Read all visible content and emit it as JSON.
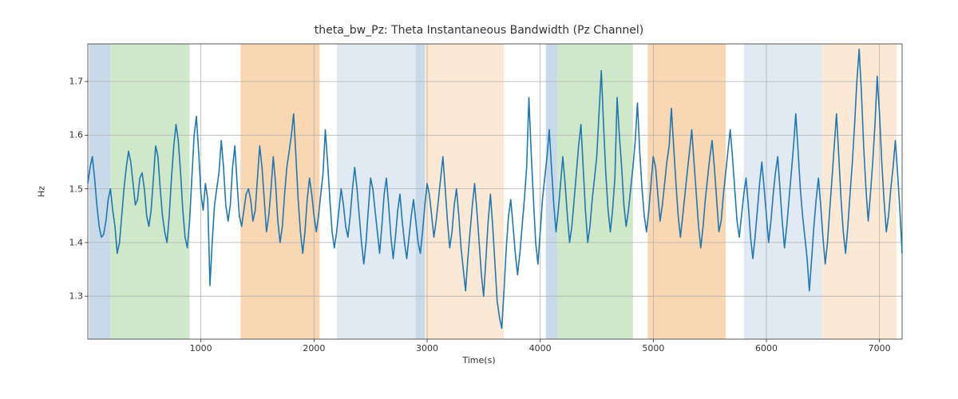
{
  "chart_data": {
    "type": "line",
    "title": "theta_bw_Pz: Theta Instantaneous Bandwidth (Pz Channel)",
    "xlabel": "Time(s)",
    "ylabel": "Hz",
    "xlim": [
      0,
      7200
    ],
    "ylim": [
      1.22,
      1.77
    ],
    "xticks": [
      1000,
      2000,
      3000,
      4000,
      5000,
      6000,
      7000
    ],
    "yticks": [
      1.3,
      1.4,
      1.5,
      1.6,
      1.7
    ],
    "bands": [
      {
        "x0": 10,
        "x1": 200,
        "color": "#b6cde2",
        "alpha": 0.75
      },
      {
        "x0": 200,
        "x1": 900,
        "color": "#bfe0b8",
        "alpha": 0.75
      },
      {
        "x0": 1350,
        "x1": 2050,
        "color": "#f7c999",
        "alpha": 0.75
      },
      {
        "x0": 2200,
        "x1": 2900,
        "color": "#d7e3ee",
        "alpha": 0.75
      },
      {
        "x0": 2900,
        "x1": 2980,
        "color": "#b6cde2",
        "alpha": 0.75
      },
      {
        "x0": 2980,
        "x1": 3680,
        "color": "#fbe2c7",
        "alpha": 0.75
      },
      {
        "x0": 4050,
        "x1": 4150,
        "color": "#b6cde2",
        "alpha": 0.75
      },
      {
        "x0": 4150,
        "x1": 4820,
        "color": "#bfe0b8",
        "alpha": 0.75
      },
      {
        "x0": 4950,
        "x1": 5640,
        "color": "#f7c999",
        "alpha": 0.75
      },
      {
        "x0": 5800,
        "x1": 6490,
        "color": "#d7e3ee",
        "alpha": 0.75
      },
      {
        "x0": 6490,
        "x1": 7150,
        "color": "#fbe2c7",
        "alpha": 0.75
      }
    ],
    "series": [
      {
        "name": "theta_bw_Pz",
        "color": "#1f77b4",
        "x_step": 20,
        "x_start": 0,
        "values": [
          1.51,
          1.54,
          1.56,
          1.52,
          1.47,
          1.43,
          1.41,
          1.415,
          1.44,
          1.48,
          1.5,
          1.46,
          1.43,
          1.38,
          1.4,
          1.45,
          1.5,
          1.54,
          1.57,
          1.55,
          1.51,
          1.47,
          1.48,
          1.52,
          1.53,
          1.5,
          1.45,
          1.43,
          1.46,
          1.52,
          1.58,
          1.56,
          1.5,
          1.45,
          1.42,
          1.4,
          1.45,
          1.52,
          1.58,
          1.62,
          1.59,
          1.53,
          1.46,
          1.41,
          1.39,
          1.44,
          1.52,
          1.6,
          1.635,
          1.57,
          1.49,
          1.46,
          1.51,
          1.48,
          1.32,
          1.4,
          1.47,
          1.5,
          1.53,
          1.59,
          1.54,
          1.47,
          1.44,
          1.47,
          1.54,
          1.58,
          1.51,
          1.45,
          1.43,
          1.46,
          1.49,
          1.5,
          1.48,
          1.44,
          1.46,
          1.52,
          1.58,
          1.54,
          1.48,
          1.42,
          1.45,
          1.5,
          1.56,
          1.51,
          1.44,
          1.4,
          1.43,
          1.49,
          1.54,
          1.57,
          1.6,
          1.64,
          1.56,
          1.48,
          1.42,
          1.38,
          1.42,
          1.48,
          1.52,
          1.49,
          1.45,
          1.42,
          1.45,
          1.49,
          1.53,
          1.61,
          1.55,
          1.48,
          1.42,
          1.39,
          1.42,
          1.46,
          1.5,
          1.47,
          1.43,
          1.41,
          1.45,
          1.5,
          1.54,
          1.5,
          1.45,
          1.4,
          1.36,
          1.4,
          1.46,
          1.52,
          1.5,
          1.46,
          1.42,
          1.38,
          1.43,
          1.49,
          1.52,
          1.47,
          1.41,
          1.37,
          1.41,
          1.46,
          1.49,
          1.44,
          1.4,
          1.37,
          1.41,
          1.45,
          1.48,
          1.44,
          1.4,
          1.38,
          1.42,
          1.47,
          1.51,
          1.49,
          1.45,
          1.41,
          1.44,
          1.48,
          1.52,
          1.56,
          1.5,
          1.44,
          1.39,
          1.42,
          1.47,
          1.5,
          1.45,
          1.39,
          1.35,
          1.31,
          1.37,
          1.42,
          1.47,
          1.51,
          1.46,
          1.4,
          1.34,
          1.3,
          1.37,
          1.44,
          1.49,
          1.43,
          1.36,
          1.29,
          1.26,
          1.24,
          1.31,
          1.39,
          1.45,
          1.48,
          1.43,
          1.38,
          1.34,
          1.38,
          1.43,
          1.48,
          1.54,
          1.67,
          1.57,
          1.48,
          1.4,
          1.36,
          1.42,
          1.48,
          1.52,
          1.56,
          1.61,
          1.54,
          1.47,
          1.42,
          1.46,
          1.51,
          1.56,
          1.51,
          1.45,
          1.4,
          1.43,
          1.48,
          1.53,
          1.58,
          1.62,
          1.54,
          1.46,
          1.4,
          1.43,
          1.48,
          1.52,
          1.56,
          1.64,
          1.72,
          1.62,
          1.53,
          1.46,
          1.42,
          1.46,
          1.52,
          1.67,
          1.6,
          1.54,
          1.47,
          1.43,
          1.46,
          1.5,
          1.54,
          1.59,
          1.66,
          1.57,
          1.5,
          1.45,
          1.42,
          1.46,
          1.51,
          1.56,
          1.54,
          1.49,
          1.44,
          1.47,
          1.51,
          1.55,
          1.58,
          1.65,
          1.58,
          1.51,
          1.45,
          1.41,
          1.45,
          1.49,
          1.53,
          1.57,
          1.61,
          1.55,
          1.49,
          1.43,
          1.39,
          1.43,
          1.48,
          1.52,
          1.56,
          1.59,
          1.54,
          1.48,
          1.42,
          1.44,
          1.49,
          1.53,
          1.57,
          1.61,
          1.56,
          1.5,
          1.44,
          1.41,
          1.45,
          1.49,
          1.52,
          1.47,
          1.41,
          1.37,
          1.41,
          1.46,
          1.51,
          1.55,
          1.5,
          1.45,
          1.4,
          1.44,
          1.49,
          1.53,
          1.56,
          1.5,
          1.44,
          1.39,
          1.43,
          1.48,
          1.53,
          1.58,
          1.64,
          1.57,
          1.5,
          1.45,
          1.41,
          1.37,
          1.31,
          1.37,
          1.43,
          1.48,
          1.52,
          1.47,
          1.41,
          1.36,
          1.4,
          1.46,
          1.52,
          1.58,
          1.64,
          1.56,
          1.48,
          1.42,
          1.38,
          1.43,
          1.49,
          1.55,
          1.62,
          1.7,
          1.76,
          1.68,
          1.58,
          1.5,
          1.44,
          1.49,
          1.55,
          1.62,
          1.71,
          1.64,
          1.55,
          1.48,
          1.42,
          1.45,
          1.5,
          1.54,
          1.59,
          1.53,
          1.46,
          1.38
        ]
      }
    ]
  }
}
